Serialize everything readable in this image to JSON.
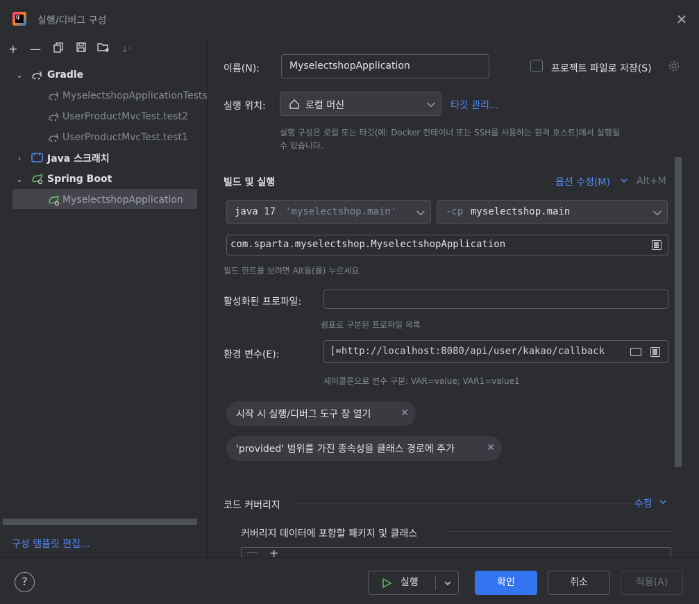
{
  "window": {
    "title": "실행/디버그 구성"
  },
  "tree": {
    "gradle": "Gradle",
    "gradle_items": [
      "MyselectshopApplicationTests",
      "UserProductMvcTest.test2",
      "UserProductMvcTest.test1"
    ],
    "java_scratch": "Java 스크래치",
    "spring_boot": "Spring Boot",
    "spring_items": [
      "MyselectshopApplication"
    ]
  },
  "left_footer": {
    "template_link": "구성 템플릿 편집..."
  },
  "form": {
    "name_label": "이름(N):",
    "name_value": "MyselectshopApplication",
    "store_label": "프로젝트 파일로 저장(S)",
    "run_on_label": "실행 위치:",
    "run_on_value": "로컬 머신",
    "manage_targets": "타깃 관리...",
    "run_on_hint_1": "실행 구성은 로컬 또는 타깃(예: Docker 컨테이너 또는 SSH를 사용하는 원격 호스트)에서 실행될",
    "run_on_hint_2": "수 있습니다.",
    "build_run_title": "빌드 및 실행",
    "modify_options": "옵션 수정(M)",
    "modify_shortcut": "Alt+M",
    "jdk_main": "java 17",
    "jdk_module": "'myselectshop.main'",
    "cp_flag": "-cp",
    "cp_value": "myselectshop.main",
    "main_class": "com.sparta.myselectshop.MyselectshopApplication",
    "field_hint": "필드 힌트를 보려면 Alt을(를) 누르세요",
    "profiles_label": "활성화된 프로파일:",
    "profiles_value": "",
    "profiles_hint": "쉼표로 구분된 프로파일 목록",
    "env_label": "환경 변수(E):",
    "env_value": "[=http://localhost:8080/api/user/kakao/callback",
    "env_hint": "세미콜론으로 변수 구분: VAR=value; VAR1=value1",
    "chip_1": "시작 시 실행/디버그 도구 창 열기",
    "chip_2": "'provided' 범위를 가진 종속성을 클래스 경로에 추가",
    "coverage_title": "코드 커버리지",
    "coverage_modify": "수정",
    "coverage_sub": "커버리지 데이터에 포함할 패키지 및 클래스"
  },
  "buttons": {
    "help": "?",
    "run": "실행",
    "ok": "확인",
    "cancel": "취소",
    "apply": "적용(A)"
  },
  "colors": {
    "accent": "#3574f0",
    "link": "#548af7",
    "background": "#2b2d30"
  }
}
